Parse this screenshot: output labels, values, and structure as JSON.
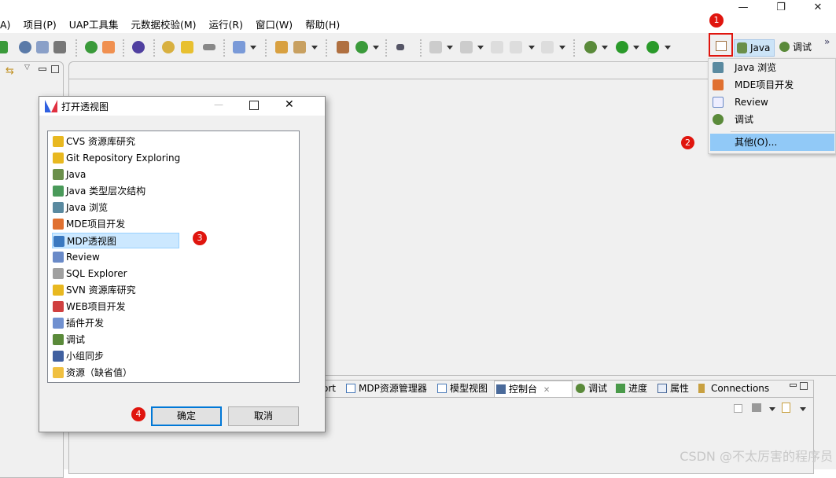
{
  "window": {
    "minimize": "—",
    "restore": "❐",
    "close": "✕"
  },
  "menubar": [
    "A)",
    "项目(P)",
    "UAP工具集",
    "元数据校验(M)",
    "运行(R)",
    "窗口(W)",
    "帮助(H)"
  ],
  "perspective_bar": {
    "open_perspective_icon": "open-perspective-icon",
    "java": "Java",
    "debug": "调试",
    "more": "»"
  },
  "perspective_menu": {
    "items": [
      {
        "label": "Java 浏览",
        "icon": "java-browse-icon"
      },
      {
        "label": "MDE项目开发",
        "icon": "mde-icon"
      },
      {
        "label": "Review",
        "icon": "review-icon"
      },
      {
        "label": "调试",
        "icon": "debug-icon"
      }
    ],
    "other": "其他(O)..."
  },
  "annotations": [
    "1",
    "2",
    "3",
    "4"
  ],
  "dialog": {
    "title": "打开透视图",
    "controls": {
      "minimize": "—",
      "maximize": "☐",
      "close": "✕"
    },
    "items": [
      {
        "label": "CVS 资源库研究",
        "color": "#e8b820"
      },
      {
        "label": "Git Repository Exploring",
        "color": "#e8b820"
      },
      {
        "label": "Java",
        "color": "#6a8f4a"
      },
      {
        "label": "Java 类型层次结构",
        "color": "#4a9a5a"
      },
      {
        "label": "Java 浏览",
        "color": "#5a8aa0"
      },
      {
        "label": "MDE项目开发",
        "color": "#e07030"
      },
      {
        "label": "MDP透视图",
        "color": "#3a78c0"
      },
      {
        "label": "Review",
        "color": "#6a8ac8"
      },
      {
        "label": "SQL Explorer",
        "color": "#a0a0a0"
      },
      {
        "label": "SVN 资源库研究",
        "color": "#e8b820"
      },
      {
        "label": "WEB项目开发",
        "color": "#d04040"
      },
      {
        "label": "插件开发",
        "color": "#7090d0"
      },
      {
        "label": "调试",
        "color": "#5a8a3a"
      },
      {
        "label": "小组同步",
        "color": "#4060a0"
      },
      {
        "label": "资源（缺省值）",
        "color": "#f0c040"
      }
    ],
    "selected_index": 6,
    "ok": "确定",
    "cancel": "取消"
  },
  "bottom_tabs": [
    {
      "label": "ort"
    },
    {
      "label": "MDP资源管理器"
    },
    {
      "label": "模型视图"
    },
    {
      "label": "控制台",
      "close": "✕",
      "active": true
    },
    {
      "label": "调试"
    },
    {
      "label": "进度"
    },
    {
      "label": "属性"
    },
    {
      "label": "Connections"
    }
  ],
  "watermark": "CSDN @不太厉害的程序员",
  "colors": {
    "accent": "#0078d7",
    "selection": "#cce8ff",
    "badge": "#e0150e",
    "menu_highlight": "#91c9f7"
  }
}
